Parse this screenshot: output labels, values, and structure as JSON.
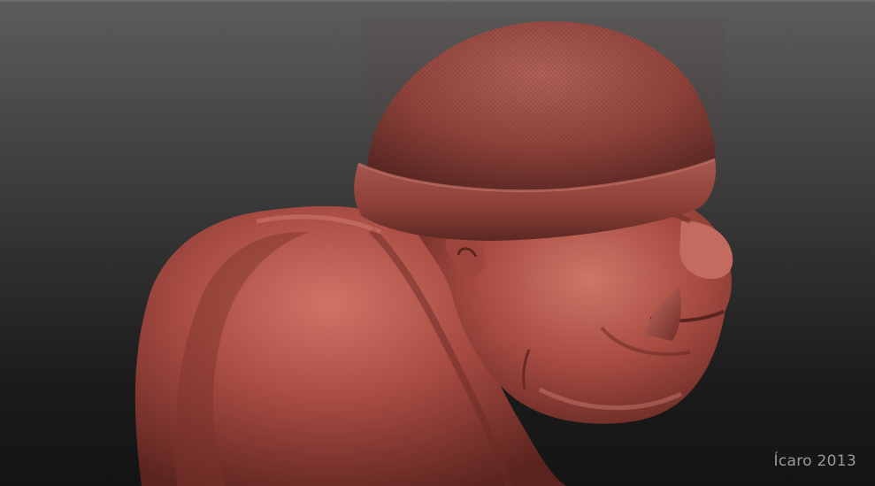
{
  "signature": "Ícaro 2013",
  "colors": {
    "skin": "#b0524a",
    "skin_shadow": "#5e2520",
    "skin_highlight": "#d27a6e",
    "hat": "#9a4a40",
    "hat_shadow": "#5a2622",
    "background_top": "#5c5c5c",
    "background_bottom": "#141414"
  }
}
